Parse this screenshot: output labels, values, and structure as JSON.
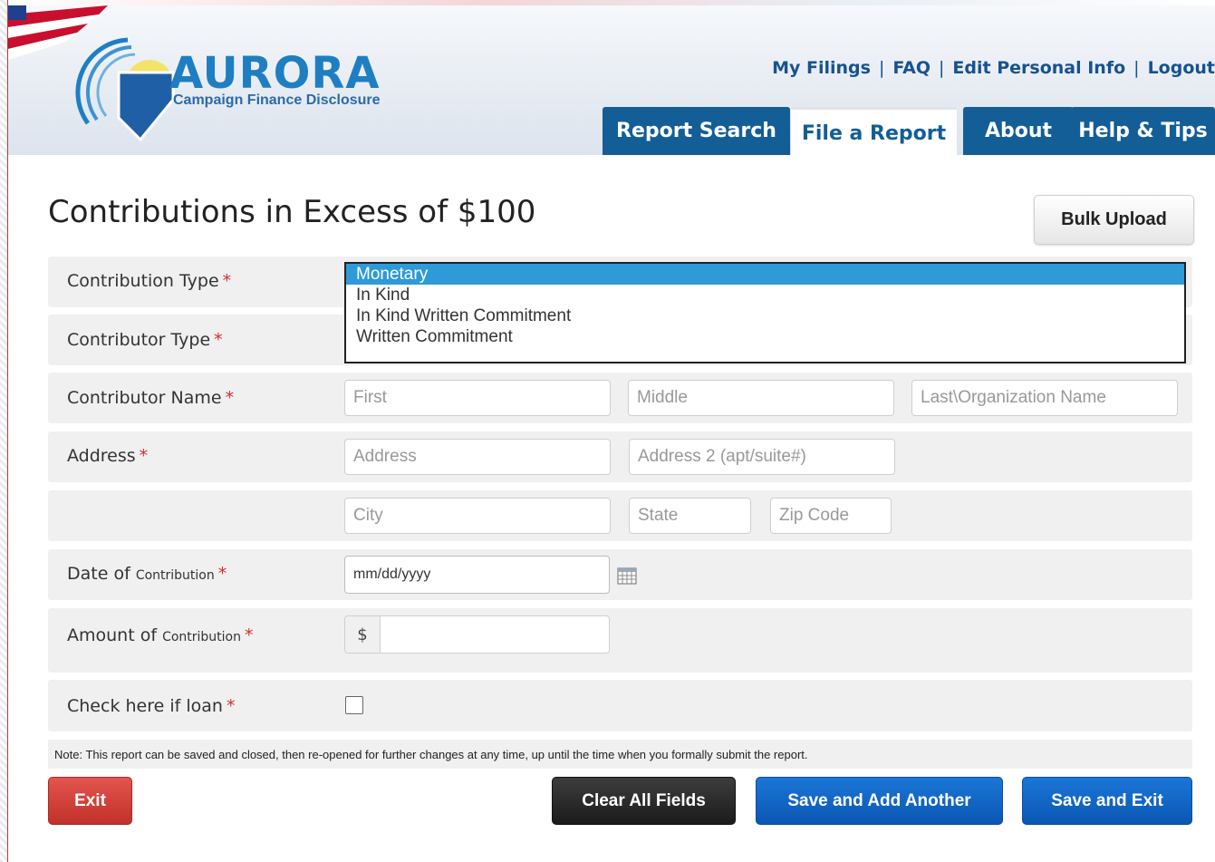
{
  "brand": {
    "title": "AURORA",
    "subtitle": "Campaign Finance Disclosure"
  },
  "top_links": [
    "My Filings",
    "FAQ",
    "Edit Personal Info",
    "Logout"
  ],
  "tabs": [
    {
      "label": "Report Search",
      "active": false
    },
    {
      "label": "File a Report",
      "active": true
    },
    {
      "label": "About",
      "active": false
    },
    {
      "label": "Help & Tips",
      "active": false
    }
  ],
  "page": {
    "title": "Contributions in Excess of $100",
    "bulk_upload": "Bulk Upload"
  },
  "form": {
    "contribution_type": {
      "label": "Contribution Type",
      "options": [
        "Monetary",
        "In Kind",
        "In Kind Written Commitment",
        "Written Commitment"
      ],
      "selected": "Monetary"
    },
    "contributor_type": {
      "label": "Contributor Type"
    },
    "contributor_name": {
      "label": "Contributor Name",
      "first_placeholder": "First",
      "middle_placeholder": "Middle",
      "last_placeholder": "Last\\Organization Name"
    },
    "address": {
      "label": "Address",
      "address_placeholder": "Address",
      "address2_placeholder": "Address 2 (apt/suite#)",
      "city_placeholder": "City",
      "state_placeholder": "State",
      "zip_placeholder": "Zip Code"
    },
    "date": {
      "label_main": "Date of ",
      "label_small": "Contribution",
      "value": "mm/dd/yyyy"
    },
    "amount": {
      "label_main": "Amount of ",
      "label_small": "Contribution",
      "currency_symbol": "$",
      "value": ""
    },
    "loan": {
      "label": "Check here if loan",
      "checked": false
    },
    "required_marker": "*"
  },
  "note": "Note: This report can be saved and closed, then re-opened for further changes at any time, up until the time when you formally submit the report.",
  "buttons": {
    "exit": "Exit",
    "clear": "Clear All Fields",
    "save_add": "Save and Add Another",
    "save_exit": "Save and Exit"
  },
  "colors": {
    "brand_blue": "#135e96",
    "selected_option": "#2e9ad8",
    "required": "#d32f2f",
    "exit_red": "#c0312a",
    "action_blue": "#0b57b4"
  }
}
